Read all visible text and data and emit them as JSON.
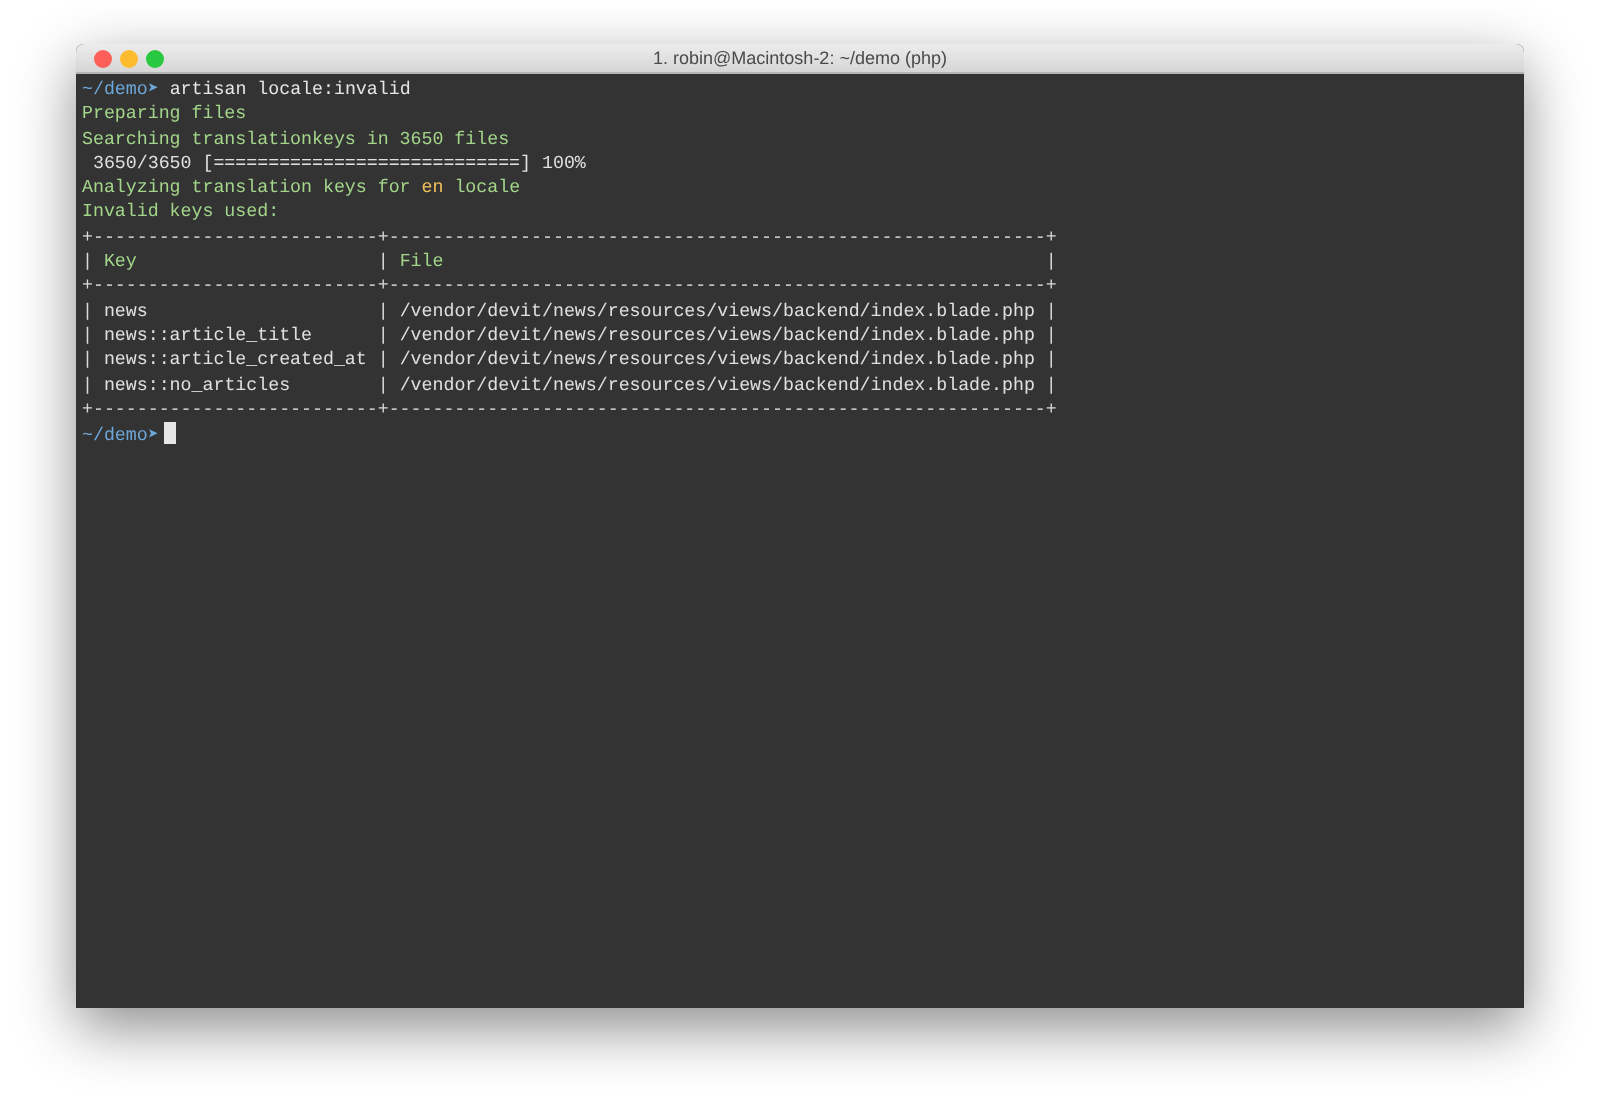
{
  "window": {
    "title": "1. robin@Macintosh-2: ~/demo (php)"
  },
  "lines": [
    [
      {
        "kind": "prompt",
        "text": "~/demo➤"
      },
      {
        "kind": "command",
        "text": " artisan locale:invalid"
      }
    ],
    [
      {
        "kind": "info",
        "text": "Preparing files"
      }
    ],
    [
      {
        "kind": "info",
        "text": "Searching translationkeys in 3650 files"
      }
    ],
    [
      {
        "kind": "plain",
        "text": " 3650/3650 [============================] 100%"
      }
    ],
    [
      {
        "kind": "info",
        "text": "Analyzing translation keys for "
      },
      {
        "kind": "highlight",
        "text": "en"
      },
      {
        "kind": "info",
        "text": " locale"
      }
    ],
    [
      {
        "kind": "info",
        "text": "Invalid keys used:"
      }
    ],
    [
      {
        "kind": "border",
        "text": "+--------------------------+------------------------------------------------------------+"
      }
    ],
    [
      {
        "kind": "border",
        "text": "| "
      },
      {
        "kind": "info",
        "text": "Key                     "
      },
      {
        "kind": "border",
        "text": " | "
      },
      {
        "kind": "info",
        "text": "File                                                      "
      },
      {
        "kind": "border",
        "text": " |"
      }
    ],
    [
      {
        "kind": "border",
        "text": "+--------------------------+------------------------------------------------------------+"
      }
    ],
    [
      {
        "kind": "border",
        "text": "| "
      },
      {
        "kind": "plain",
        "text": "news                    "
      },
      {
        "kind": "border",
        "text": " | "
      },
      {
        "kind": "plain",
        "text": "/vendor/devit/news/resources/views/backend/index.blade.php"
      },
      {
        "kind": "border",
        "text": " |"
      }
    ],
    [
      {
        "kind": "border",
        "text": "| "
      },
      {
        "kind": "plain",
        "text": "news::article_title     "
      },
      {
        "kind": "border",
        "text": " | "
      },
      {
        "kind": "plain",
        "text": "/vendor/devit/news/resources/views/backend/index.blade.php"
      },
      {
        "kind": "border",
        "text": " |"
      }
    ],
    [
      {
        "kind": "border",
        "text": "| "
      },
      {
        "kind": "plain",
        "text": "news::article_created_at"
      },
      {
        "kind": "border",
        "text": " | "
      },
      {
        "kind": "plain",
        "text": "/vendor/devit/news/resources/views/backend/index.blade.php"
      },
      {
        "kind": "border",
        "text": " |"
      }
    ],
    [
      {
        "kind": "border",
        "text": "| "
      },
      {
        "kind": "plain",
        "text": "news::no_articles       "
      },
      {
        "kind": "border",
        "text": " | "
      },
      {
        "kind": "plain",
        "text": "/vendor/devit/news/resources/views/backend/index.blade.php"
      },
      {
        "kind": "border",
        "text": " |"
      }
    ],
    [
      {
        "kind": "border",
        "text": "+--------------------------+------------------------------------------------------------+"
      }
    ],
    [
      {
        "kind": "prompt",
        "text": "~/demo➤"
      },
      {
        "kind": "cursor"
      }
    ]
  ]
}
